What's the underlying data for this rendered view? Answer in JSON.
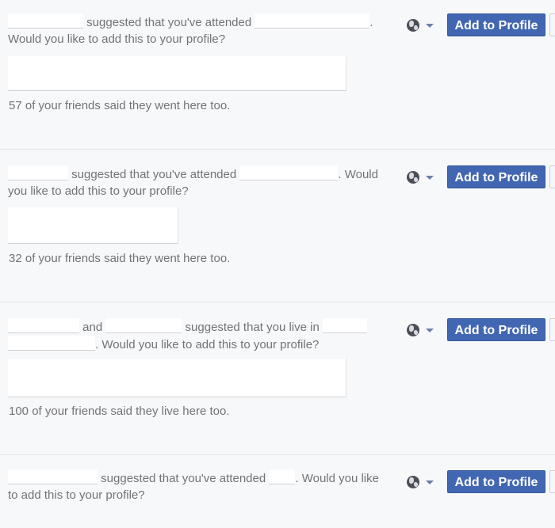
{
  "suggestions": [
    {
      "text_1": "suggested that you've attended",
      "text_2": ".",
      "text_3": "Would you like to add this to your profile?",
      "friends_text": "57 of your friends said they went here too.",
      "privacy_icon": "globe-icon",
      "add_label": "Add to Profile"
    },
    {
      "text_1": "suggested that you've attended",
      "text_2": ". Would",
      "text_3": "you like to add this to your profile?",
      "friends_text": "32 of your friends said they went here too.",
      "privacy_icon": "globe-icon",
      "add_label": "Add to Profile"
    },
    {
      "text_1": "and",
      "text_2": "suggested that you live in",
      "text_3": ". Would you like to add this to your profile?",
      "friends_text": "100 of your friends said they live here too.",
      "privacy_icon": "globe-icon",
      "add_label": "Add to Profile"
    },
    {
      "text_1": "suggested that you've attended",
      "text_2": ". Would you like",
      "text_3": "to add this to your profile?",
      "privacy_icon": "globe-icon",
      "add_label": "Add to Profile"
    }
  ],
  "colors": {
    "button": "#4267b2",
    "background": "#f7f8fa",
    "text": "#737373"
  }
}
